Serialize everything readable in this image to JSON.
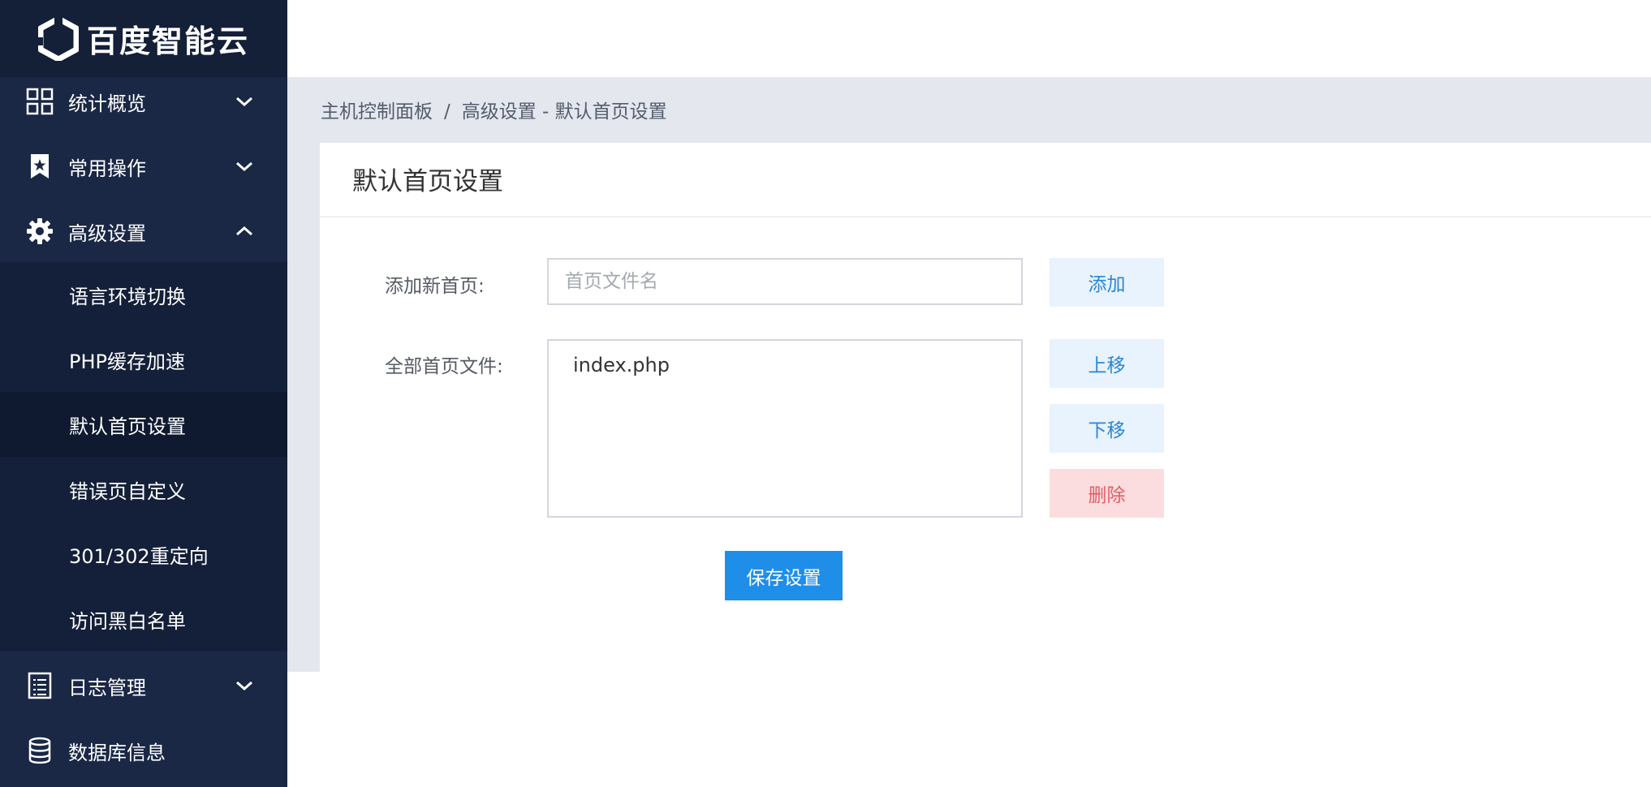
{
  "brand": {
    "name": "百度智能云",
    "logo_icon": "baidu-cloud-hexagon-logo"
  },
  "sidebar": {
    "groups": [
      {
        "label": "统计概览",
        "icon": "dashboard-grid-icon",
        "expanded": false
      },
      {
        "label": "常用操作",
        "icon": "bookmark-star-icon",
        "expanded": false
      },
      {
        "label": "高级设置",
        "icon": "gear-icon",
        "expanded": true
      },
      {
        "label": "日志管理",
        "icon": "document-list-icon",
        "expanded": false
      },
      {
        "label": "数据库信息",
        "icon": "database-icon"
      }
    ],
    "advanced_items": [
      {
        "label": "语言环境切换"
      },
      {
        "label": "PHP缓存加速"
      },
      {
        "label": "默认首页设置",
        "active": true
      },
      {
        "label": "错误页自定义"
      },
      {
        "label": "301/302重定向"
      },
      {
        "label": "访问黑白名单"
      }
    ]
  },
  "breadcrumb": {
    "root": "主机控制面板",
    "separator": "/",
    "current": "高级设置 - 默认首页设置"
  },
  "panel": {
    "title": "默认首页设置",
    "add_label": "添加新首页:",
    "add_placeholder": "首页文件名",
    "add_value": "",
    "add_button": "添加",
    "files_label": "全部首页文件:",
    "files": [
      "index.php"
    ],
    "move_up_button": "上移",
    "move_down_button": "下移",
    "delete_button": "删除",
    "save_button": "保存设置"
  },
  "colors": {
    "sidebar_bg": "#1a2745",
    "primary": "#1f8ee9",
    "light_button_bg": "#e8f3fd",
    "danger_bg": "#fbdddf",
    "danger_text": "#e25d66"
  }
}
